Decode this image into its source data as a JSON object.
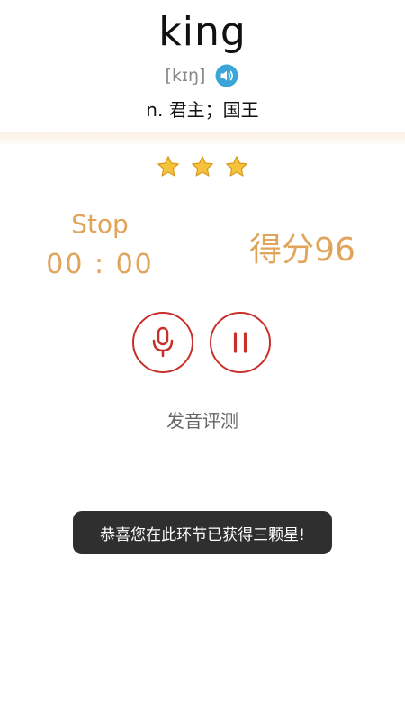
{
  "word": {
    "text": "king",
    "phonetic": "[kɪŋ]",
    "meaning": "n. 君主；国王",
    "speaker_icon": "speaker-icon"
  },
  "rating": {
    "stars_earned": 3,
    "stars_total": 3,
    "star_color": "#f5c33b"
  },
  "recording": {
    "status_label": "Stop",
    "timer": "00 : 00",
    "score": "得分96"
  },
  "controls": {
    "mic_icon": "microphone-icon",
    "pause_icon": "pause-icon",
    "accent_color": "#c8302a"
  },
  "section": {
    "label": "发音评测"
  },
  "toast": {
    "message": "恭喜您在此环节已获得三颗星!"
  }
}
